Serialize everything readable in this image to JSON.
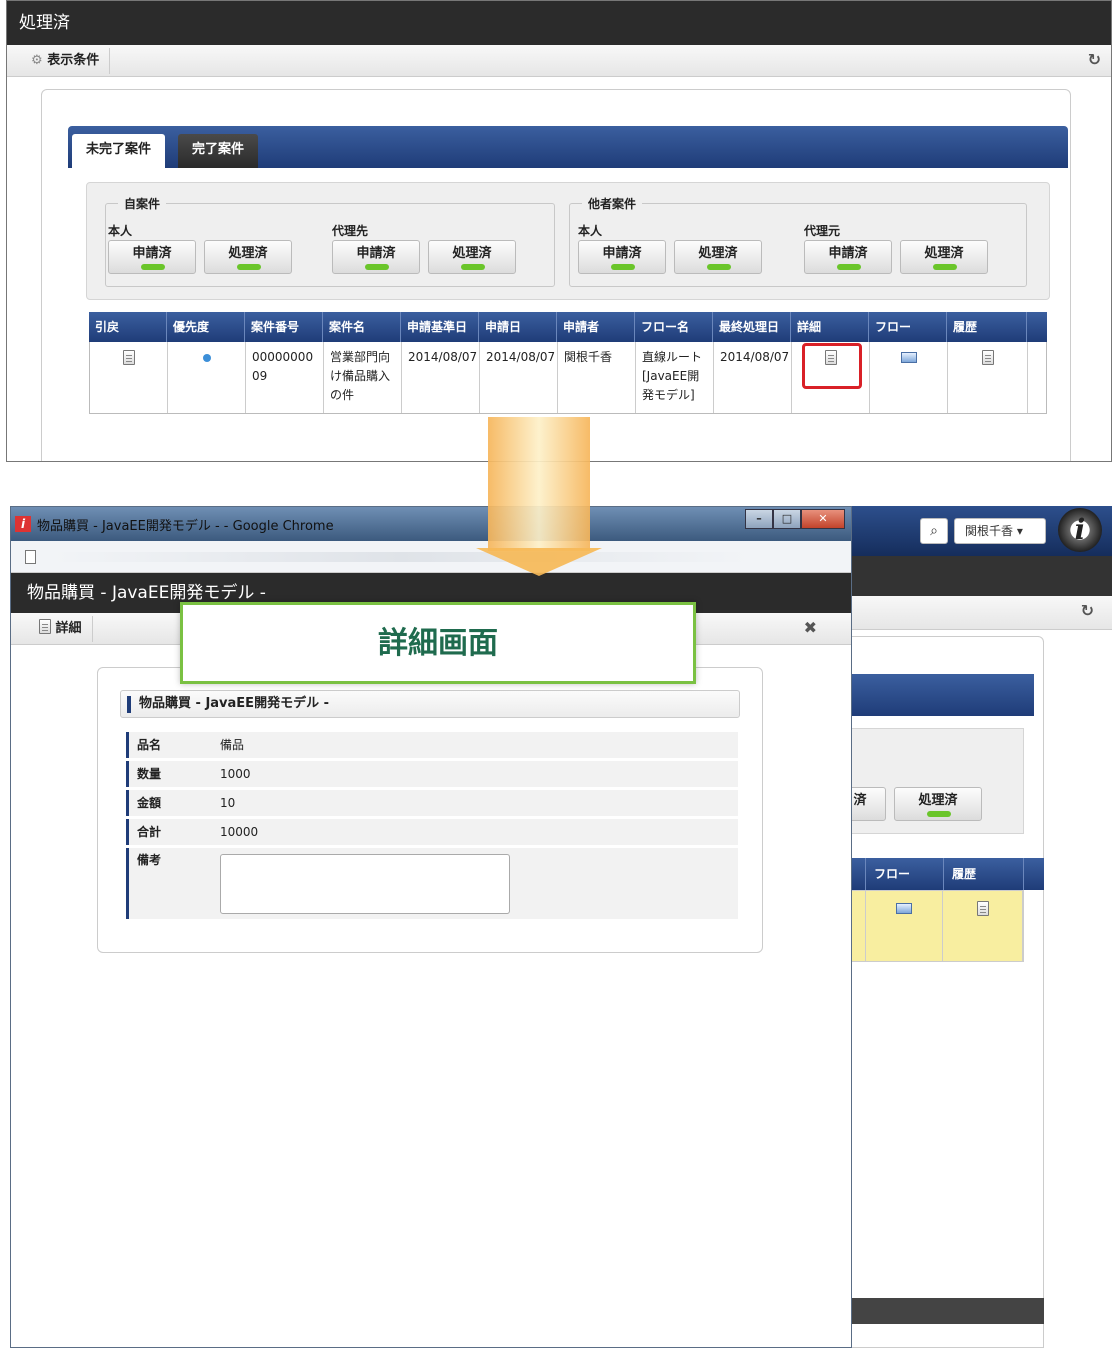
{
  "top": {
    "title": "処理済",
    "toolbar_label": "表示条件",
    "tabs": [
      {
        "label": "未完了案件"
      },
      {
        "label": "完了案件"
      }
    ],
    "groups": [
      {
        "legend": "自案件",
        "sub1": "本人",
        "sub2": "代理先"
      },
      {
        "legend": "他者案件",
        "sub1": "本人",
        "sub2": "代理元"
      }
    ],
    "buttons": {
      "applied": "申請済",
      "processed": "処理済"
    },
    "columns": [
      "引戻",
      "優先度",
      "案件番号",
      "案件名",
      "申請基準日",
      "申請日",
      "申請者",
      "フロー名",
      "最終処理日",
      "詳細",
      "フロー",
      "履歴"
    ],
    "row": {
      "case_number": "00000000 09",
      "case_name": "営業部門向け備品購入の件",
      "base_date": "2014/08/07",
      "applied_date": "2014/08/07",
      "applicant": "関根千香",
      "flow_name": "直線ルート[JavaEE開発モデル]",
      "last_processed": "2014/08/07"
    }
  },
  "background_app": {
    "search_icon": "search-icon",
    "user_name": "関根千香",
    "logo_letter": "i",
    "processed_button": "処理済",
    "cut_text": "済",
    "columns": [
      "フロー",
      "履歴"
    ]
  },
  "window": {
    "chrome_title": "物品購買 - JavaEE開発モデル - - Google Chrome",
    "inner_title": "物品購買 - JavaEE開発モデル -",
    "toolbar_label": "詳細",
    "section_title": "物品購買 - JavaEE開発モデル -",
    "fields": [
      {
        "label": "品名",
        "value": "備品"
      },
      {
        "label": "数量",
        "value": "1000"
      },
      {
        "label": "金額",
        "value": "10"
      },
      {
        "label": "合計",
        "value": "10000"
      },
      {
        "label": "備考",
        "value": ""
      }
    ]
  },
  "callout": "詳細画面",
  "colors": {
    "header_blue": "#1f3c78",
    "accent_green": "#6ac52a",
    "highlight_red": "#d92027",
    "callout_border": "#7ac142"
  }
}
